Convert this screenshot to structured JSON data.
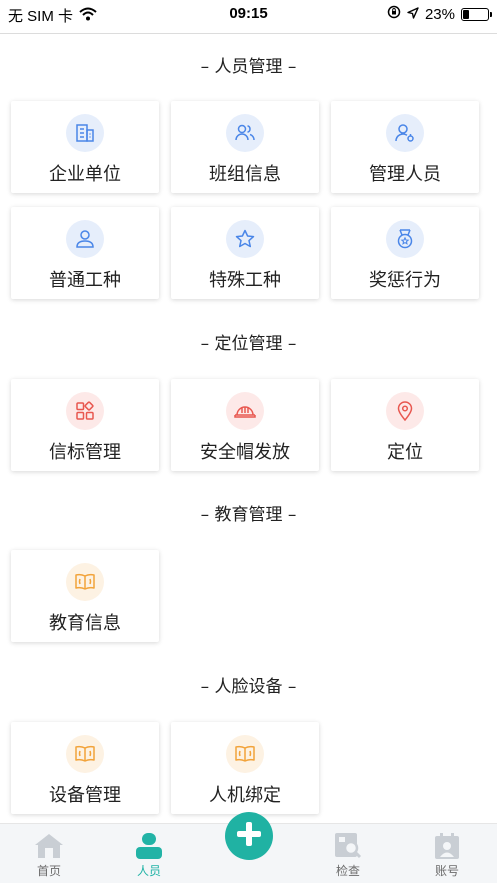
{
  "status_bar": {
    "carrier": "无 SIM 卡",
    "time": "09:15",
    "battery": "23%",
    "battery_level": 0.23
  },
  "sections": [
    {
      "title": "– 人员管理 –",
      "items": [
        {
          "label": "企业单位",
          "icon": "building-icon"
        },
        {
          "label": "班组信息",
          "icon": "group-icon"
        },
        {
          "label": "管理人员",
          "icon": "user-settings-icon"
        },
        {
          "label": "普通工种",
          "icon": "user-icon"
        },
        {
          "label": "特殊工种",
          "icon": "star-icon"
        },
        {
          "label": "奖惩行为",
          "icon": "medal-icon"
        }
      ]
    },
    {
      "title": "– 定位管理 –",
      "items": [
        {
          "label": "信标管理",
          "icon": "beacon-grid-icon"
        },
        {
          "label": "安全帽发放",
          "icon": "helmet-icon"
        },
        {
          "label": "定位",
          "icon": "location-pin-icon"
        }
      ]
    },
    {
      "title": "– 教育管理 –",
      "items": [
        {
          "label": "教育信息",
          "icon": "book-icon"
        }
      ]
    },
    {
      "title": "– 人脸设备 –",
      "items": [
        {
          "label": "设备管理",
          "icon": "book-icon"
        },
        {
          "label": "人机绑定",
          "icon": "book-icon"
        }
      ]
    }
  ],
  "tab_bar": {
    "tabs": [
      {
        "label": "首页",
        "icon": "home-icon"
      },
      {
        "label": "人员",
        "icon": "person-icon",
        "active": true
      },
      {
        "label": "检查",
        "icon": "inspect-icon"
      },
      {
        "label": "账号",
        "icon": "account-icon"
      }
    ],
    "fab_icon": "plus-icon"
  },
  "colors": {
    "accent": "#20b2a3",
    "icon_blue": "#4a86e8",
    "icon_red": "#e8574f",
    "icon_orange": "#f2a33a"
  }
}
